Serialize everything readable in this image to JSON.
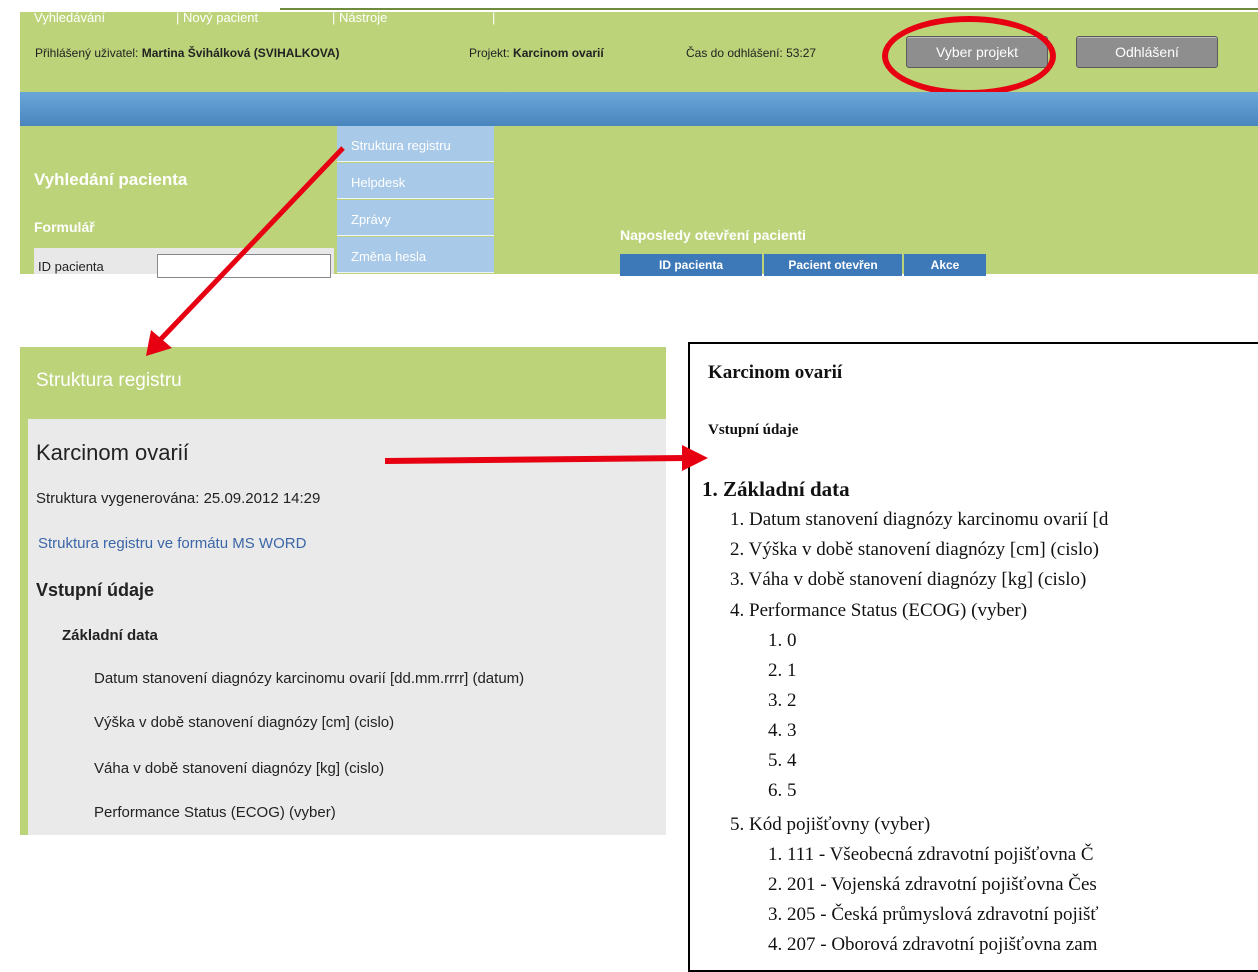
{
  "header": {
    "user_label": "Přihlášený uživatel:",
    "user_name": "Martina Švihálková (SVIHALKOVA)",
    "project_label": "Projekt:",
    "project_name": "Karcinom ovarií",
    "timeout_label": "Čas do odhlášení:",
    "timeout_value": "53:27",
    "select_project_button": "Vyber projekt",
    "logout_button": "Odhlášení"
  },
  "nav": {
    "items": [
      "Vyhledávání",
      "| Nový pacient",
      "| Nástroje",
      "|"
    ]
  },
  "dropdown": {
    "items": [
      "Struktura registru",
      "Helpdesk",
      "Zprávy",
      "Změna hesla"
    ]
  },
  "main": {
    "page_title": "Vyhledání pacienta",
    "form_title": "Formulář",
    "patient_id_label": "ID pacienta",
    "recent_title": "Naposledy otevření pacienti",
    "recent_columns": [
      "ID pacienta",
      "Pacient otevřen",
      "Akce"
    ]
  },
  "structure": {
    "title": "Struktura registru",
    "project": "Karcinom ovarií",
    "generated": "Struktura vygenerována: 25.09.2012 14:29",
    "word_link": "Struktura registru ve formátu MS WORD",
    "section": "Vstupní údaje",
    "subsection": "Základní data",
    "fields": [
      "Datum stanovení diagnózy karcinomu ovarií [dd.mm.rrrr] (datum)",
      "Výška v době stanovení diagnózy [cm] (cislo)",
      "Váha v době stanovení diagnózy [kg] (cislo)",
      "Performance Status (ECOG) (vyber)"
    ]
  },
  "doc": {
    "title": "Karcinom ovarií",
    "section": "Vstupní údaje",
    "heading": "1.  Základní data",
    "items": [
      "1.  Datum stanovení diagnózy karcinomu ovarií [d",
      "2.  Výška v době stanovení diagnózy [cm] (cislo)",
      "3.  Váha v době stanovení diagnózy [kg] (cislo)",
      "4.  Performance Status (ECOG) (vyber)"
    ],
    "ecog_options": [
      "1.  0",
      "2.  1",
      "3.  2",
      "4.  3",
      "5.  4",
      "6.  5"
    ],
    "item5": "5.  Kód pojišťovny (vyber)",
    "insurers": [
      "1.  111 - Všeobecná zdravotní pojišťovna Č",
      "2.  201 - Vojenská zdravotní pojišťovna Čes",
      "3.  205 - Česká průmyslová zdravotní pojišť",
      "4.  207 - Oborová zdravotní pojišťovna zam"
    ]
  }
}
